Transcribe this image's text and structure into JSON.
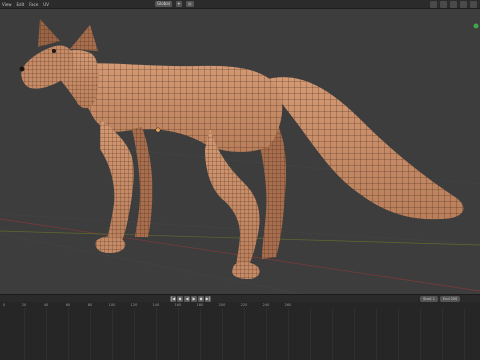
{
  "header": {
    "menu": [
      "View",
      "Edit",
      "Face",
      "UV"
    ],
    "transform_orientation": "Global",
    "icons": [
      "object-mode-icon",
      "snap-icon",
      "proportional-icon",
      "overlay-icon",
      "shading-icon"
    ]
  },
  "viewport": {
    "object_name": "Fox",
    "mode": "Sculpt/Edit wireframe overlay",
    "colors": {
      "background": "#3d3d3d",
      "mesh": "#c58a66",
      "mesh_dark": "#8a5a3e",
      "wire": "#2a1b12",
      "axis_x": "#7f3a3a",
      "axis_y": "#5c6b2e",
      "grid": "#444444"
    }
  },
  "timeline": {
    "transport_icons": [
      "jump-start-icon",
      "prev-key-icon",
      "play-reverse-icon",
      "play-icon",
      "next-key-icon",
      "jump-end-icon"
    ],
    "transport_glyphs": [
      "|◀",
      "◆",
      "◀",
      "▶",
      "◆",
      "▶|"
    ],
    "ruler_labels": [
      "0",
      "20",
      "40",
      "60",
      "80",
      "100",
      "120",
      "140",
      "160",
      "180",
      "200",
      "220",
      "240",
      "260"
    ],
    "start_label": "Start",
    "start_value": "1",
    "end_label": "End",
    "end_value": "250"
  }
}
